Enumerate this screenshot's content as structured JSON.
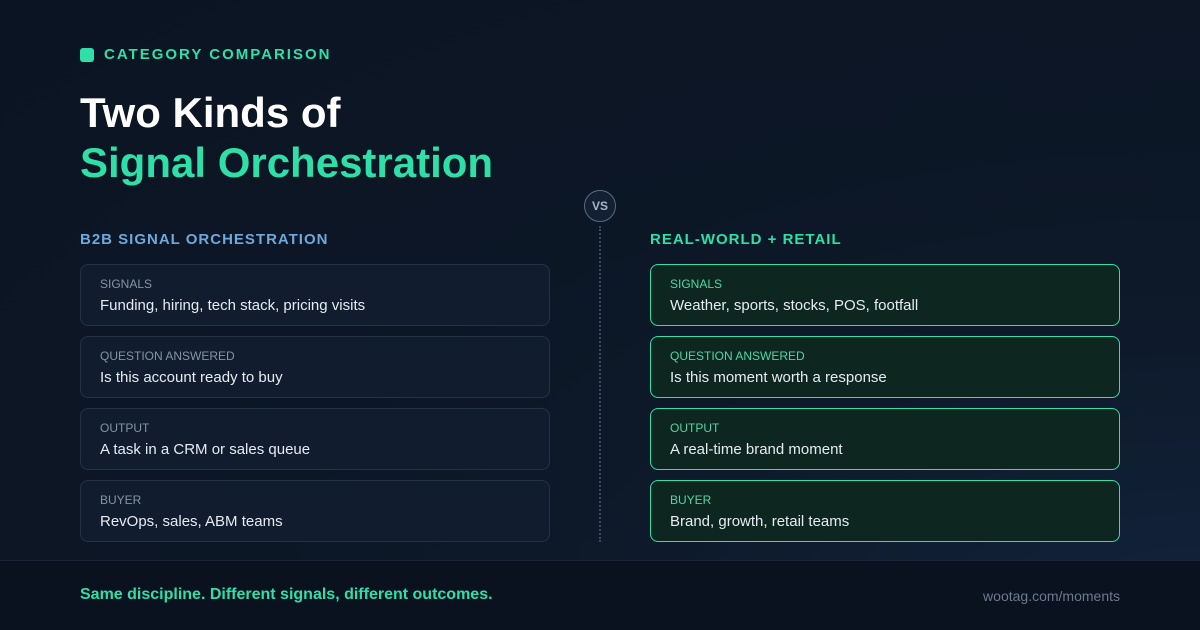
{
  "eyebrow": "CATEGORY COMPARISON",
  "title": {
    "line1": "Two Kinds of",
    "line2": "Signal Orchestration"
  },
  "vs_label": "VS",
  "left": {
    "title": "B2B SIGNAL ORCHESTRATION",
    "cards": [
      {
        "label": "SIGNALS",
        "value": "Funding, hiring, tech stack, pricing visits"
      },
      {
        "label": "QUESTION ANSWERED",
        "value": "Is this account ready to buy"
      },
      {
        "label": "OUTPUT",
        "value": "A task in a CRM or sales queue"
      },
      {
        "label": "BUYER",
        "value": "RevOps, sales, ABM teams"
      }
    ]
  },
  "right": {
    "title": "REAL-WORLD + RETAIL",
    "cards": [
      {
        "label": "SIGNALS",
        "value": "Weather, sports, stocks, POS, footfall"
      },
      {
        "label": "QUESTION ANSWERED",
        "value": "Is this moment worth a response"
      },
      {
        "label": "OUTPUT",
        "value": "A real-time brand moment"
      },
      {
        "label": "BUYER",
        "value": "Brand, growth, retail teams"
      }
    ]
  },
  "footer": {
    "tagline": "Same discipline. Different signals, different outcomes.",
    "url": "wootag.com/moments"
  },
  "colors": {
    "accent": "#2ee0a8",
    "left_title": "#6fa8dc",
    "background": "#0d1828"
  }
}
